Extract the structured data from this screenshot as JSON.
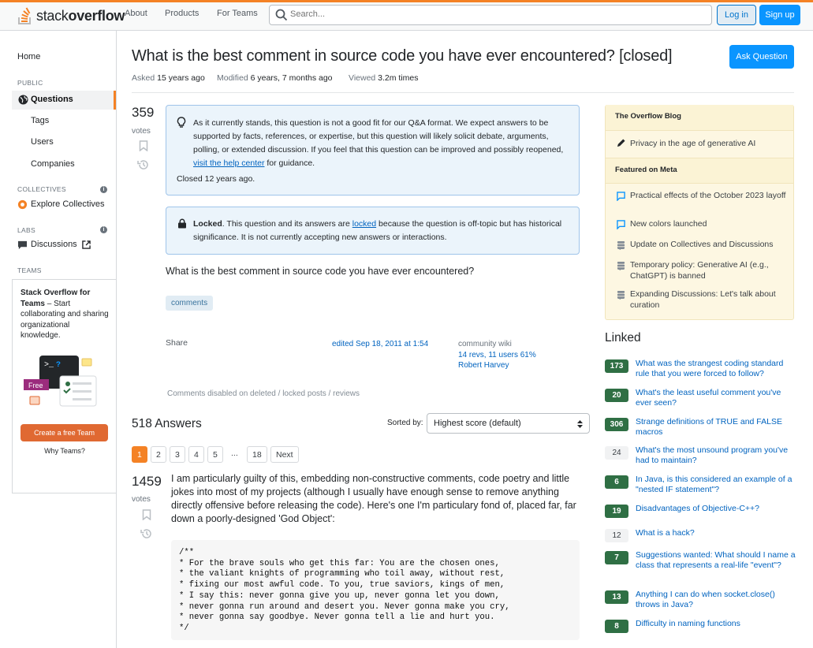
{
  "colors": {
    "brand_orange": "#f48225",
    "link_blue": "#0063bf",
    "button_blue": "#0a95ff",
    "accepted_green": "#2f6f44"
  },
  "topbar": {
    "logo_text_light": "stack",
    "logo_text_bold": "overflow",
    "nav": [
      "About",
      "Products",
      "For Teams"
    ],
    "search_placeholder": "Search...",
    "login": "Log in",
    "signup": "Sign up"
  },
  "sidebar": {
    "home": "Home",
    "public_heading": "PUBLIC",
    "questions": "Questions",
    "tags": "Tags",
    "users": "Users",
    "companies": "Companies",
    "collectives_heading": "COLLECTIVES",
    "explore_collectives": "Explore Collectives",
    "labs_heading": "LABS",
    "discussions": "Discussions",
    "teams_heading": "TEAMS",
    "teams_title": "Stack Overflow for Teams",
    "teams_desc": " – Start collaborating and sharing organizational knowledge.",
    "free_badge": "Free",
    "create_team": "Create a free Team",
    "why_teams": "Why Teams?"
  },
  "question": {
    "title": "What is the best comment in source code you have ever encountered? [closed]",
    "ask_button": "Ask Question",
    "asked_label": "Asked",
    "asked_value": "15 years ago",
    "modified_label": "Modified",
    "modified_value": "6 years, 7 months ago",
    "viewed_label": "Viewed",
    "viewed_value": "3.2m times",
    "votes": "359",
    "votes_label": "votes",
    "notice_text": "As it currently stands, this question is not a good fit for our Q&A format. We expect answers to be supported by facts, references, or expertise, but this question will likely solicit debate, arguments, polling, or extended discussion. If you feel that this question can be improved and possibly reopened, ",
    "notice_link": "visit the help center",
    "notice_tail": " for guidance.",
    "closed_text": "Closed 12 years ago.",
    "locked_bold": "Locked",
    "locked_pre": ". This question and its answers are ",
    "locked_link": "locked",
    "locked_tail": " because the question is off-topic but has historical significance. It is not currently accepting new answers or interactions.",
    "body": "What is the best comment in source code you have ever encountered?",
    "tag": "comments",
    "share": "Share",
    "edited": "edited Sep 18, 2011 at 1:54",
    "community_wiki": "community wiki",
    "revs": "14 revs, 11 users 61%",
    "author": "Robert Harvey",
    "comments_disabled": "Comments disabled on deleted / locked posts / reviews"
  },
  "answers": {
    "heading": "518 Answers",
    "sorted_label": "Sorted by:",
    "sort_value": "Highest score (default)",
    "pages": [
      "1",
      "2",
      "3",
      "4",
      "5",
      "...",
      "18",
      "Next"
    ],
    "top_votes": "1459",
    "votes_label": "votes",
    "top_text": "I am particularly guilty of this, embedding non-constructive comments, code poetry and little jokes into most of my projects (although I usually have enough sense to remove anything directly offensive before releasing the code). Here's one I'm particulary fond of, placed far, far down a poorly-designed 'God Object':",
    "code": "/**\n* For the brave souls who get this far: You are the chosen ones,\n* the valiant knights of programming who toil away, without rest,\n* fixing our most awful code. To you, true saviors, kings of men,\n* I say this: never gonna give you up, never gonna let you down,\n* never gonna run around and desert you. Never gonna make you cry,\n* never gonna say goodbye. Never gonna tell a lie and hurt you.\n*/"
  },
  "right": {
    "blog_heading": "The Overflow Blog",
    "blog_item": "Privacy in the age of generative AI",
    "meta_heading": "Featured on Meta",
    "meta_items": [
      "Practical effects of the October 2023 layoff",
      "New colors launched",
      "Update on Collectives and Discussions",
      "Temporary policy: Generative AI (e.g., ChatGPT) is banned",
      "Expanding Discussions: Let's talk about curation"
    ],
    "linked_heading": "Linked",
    "linked": [
      {
        "score": "173",
        "text": "What was the strangest coding standard rule that you were forced to follow?",
        "accepted": true
      },
      {
        "score": "20",
        "text": "What's the least useful comment you've ever seen?",
        "accepted": true
      },
      {
        "score": "306",
        "text": "Strange definitions of TRUE and FALSE macros",
        "accepted": true
      },
      {
        "score": "24",
        "text": "What's the most unsound program you've had to maintain?",
        "accepted": false
      },
      {
        "score": "6",
        "text": "In Java, is this considered an example of a \"nested IF statement\"?",
        "accepted": true
      },
      {
        "score": "19",
        "text": "Disadvantages of Objective-C++?",
        "accepted": true
      },
      {
        "score": "12",
        "text": "What is a hack?",
        "accepted": false
      },
      {
        "score": "7",
        "text": "Suggestions wanted: What should I name a class that represents a real-life \"event\"?",
        "accepted": true
      },
      {
        "score": "13",
        "text": "Anything I can do when socket.close() throws in Java?",
        "accepted": true
      },
      {
        "score": "8",
        "text": "Difficulty in naming functions",
        "accepted": true
      }
    ]
  }
}
